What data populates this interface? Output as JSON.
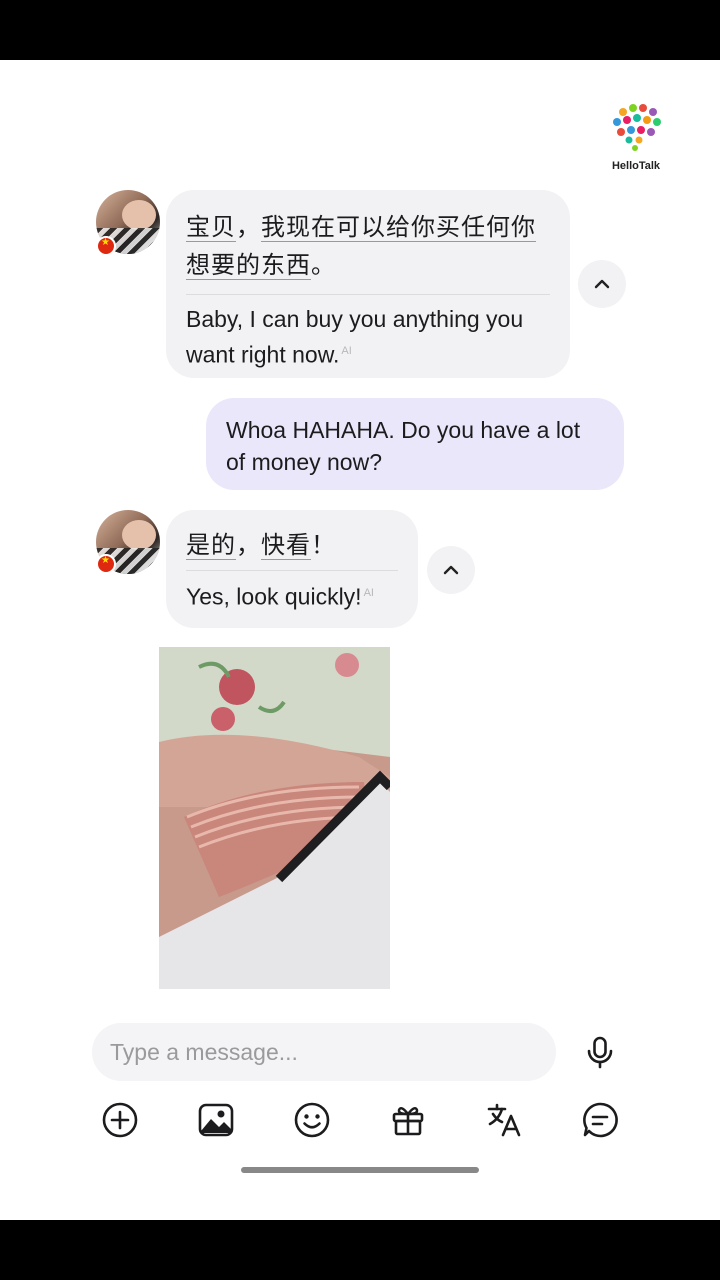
{
  "app": {
    "brand": "HelloTalk"
  },
  "messages": [
    {
      "id": 1,
      "direction": "incoming",
      "original_segments": [
        "宝贝",
        "，",
        "我",
        "现在",
        "可以",
        "给",
        "你",
        "买",
        "任何",
        "你",
        "想要",
        "的",
        "东西",
        "。"
      ],
      "translation": "Baby, I can buy you anything you want right now.",
      "translation_badge": "AI"
    },
    {
      "id": 2,
      "direction": "outgoing",
      "text": "Whoa HAHAHA. Do you have a lot of money now?"
    },
    {
      "id": 3,
      "direction": "incoming",
      "original_segments": [
        "是",
        "的",
        "，",
        "快",
        "看",
        "！"
      ],
      "translation": "Yes, look quickly!",
      "translation_badge": "AI"
    },
    {
      "id": 4,
      "direction": "incoming",
      "type": "image"
    }
  ],
  "composer": {
    "placeholder": "Type a message..."
  },
  "toolbar": {
    "icons": [
      "add-icon",
      "image-icon",
      "emoji-icon",
      "gift-icon",
      "translate-icon",
      "chat-icon"
    ]
  },
  "colors": {
    "incoming_bubble": "#f2f2f4",
    "outgoing_bubble": "#ebe7fb",
    "flag": "#de2910"
  }
}
